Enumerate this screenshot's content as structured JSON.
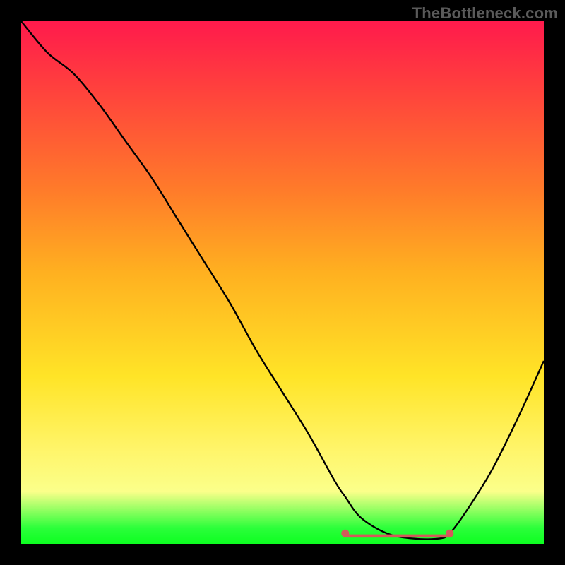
{
  "watermark": "TheBottleneck.com",
  "colors": {
    "marker": "#d35a5a",
    "line": "#000000"
  },
  "chart_data": {
    "type": "line",
    "title": "",
    "xlabel": "",
    "ylabel": "",
    "xlim": [
      0,
      100
    ],
    "ylim": [
      0,
      100
    ],
    "grid": false,
    "legend": false,
    "series": [
      {
        "name": "curve",
        "x": [
          0,
          5,
          10,
          15,
          20,
          25,
          30,
          35,
          40,
          45,
          50,
          55,
          60,
          62,
          65,
          70,
          75,
          80,
          82,
          85,
          90,
          95,
          100
        ],
        "y": [
          100,
          94,
          90,
          84,
          77,
          70,
          62,
          54,
          46,
          37,
          29,
          21,
          12,
          9,
          5,
          2,
          1,
          1,
          2,
          6,
          14,
          24,
          35
        ]
      }
    ],
    "flat_region": {
      "x_start": 62,
      "x_end": 82,
      "y": 1.5
    },
    "markers": [
      {
        "x": 62,
        "y": 2
      },
      {
        "x": 82,
        "y": 2
      }
    ]
  }
}
